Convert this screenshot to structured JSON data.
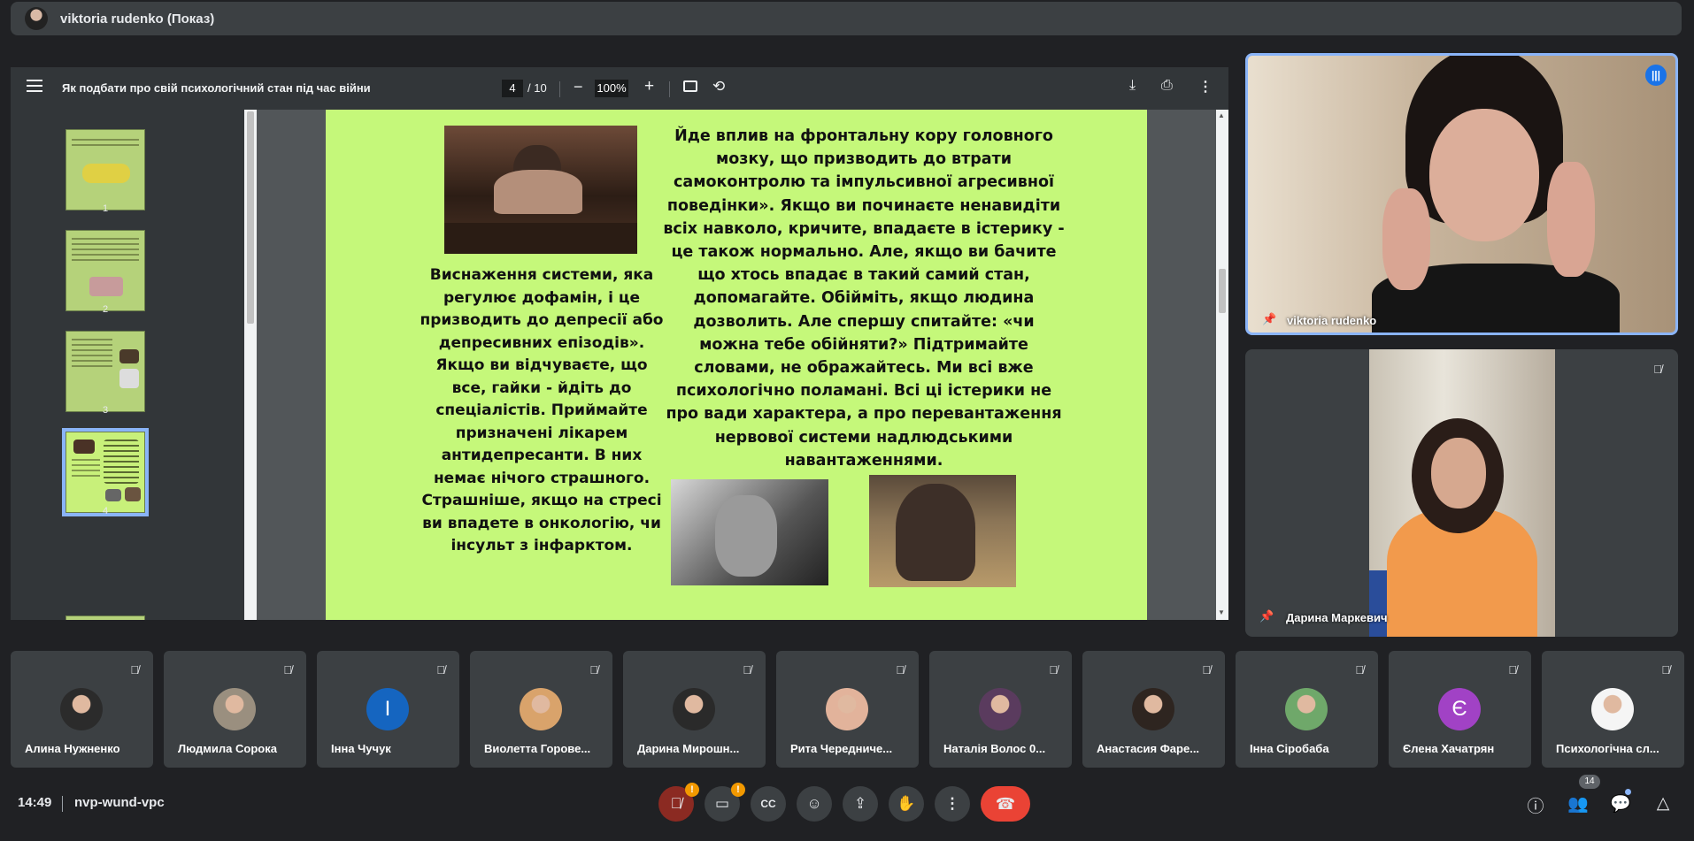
{
  "presenter_bar": {
    "title": "viktoria rudenko (Показ)"
  },
  "pdf": {
    "title": "Як подбати про свій психологічний стан під час війни",
    "page_current": "4",
    "page_total": "/ 10",
    "zoom": "100%",
    "thumbnail_numbers": [
      "1",
      "2",
      "3",
      "4"
    ],
    "slide_text_left": "Виснаження системи, яка\nрегулює дофамін, і це\nпризводить до депресії або\nдепресивних епізодів».\nЯкщо ви відчуваєте, що\nвсе, гайки - йдіть до\nспеціалістів. Приймайте\nпризначені лікарем\nантидепресанти. В них\nнемає нічого страшного.\nСтрашніше, якщо на стресі\nви впадете в онкологію, чи\nінсульт з інфарктом.",
    "slide_text_right": "Йде вплив на фронтальну кору головного\nмозку, що призводить до втрати\nсамоконтролю та імпульсивної агресивної\nповедінки». Якщо ви починаєте ненавидіти\nвсіх навколо, кричите, впадаєте в істерику -\nце також нормально. Але, якщо ви бачите\nщо хтось впадає в такий самий стан,\nдопомагайте. Обійміть, якщо людина\nдозволить. Але спершу спитайте: «чи\nможна тебе обійняти?» Підтримайте\nсловами, не ображайтесь. Ми всі вже\nпсихологічно поламані. Всі ці істерики не\nпро вади характера, а про перевантаження\nнервової системи надлюдськими\nнавантаженнями.",
    "icons": {
      "menu": "menu-icon",
      "fit": "fit-page-icon",
      "rotate": "rotate-icon",
      "download": "download-icon",
      "print": "print-icon",
      "more": "more-vert-icon"
    }
  },
  "main_tiles": [
    {
      "name": "viktoria rudenko"
    },
    {
      "name": "Дарина Маркевич"
    }
  ],
  "participants": [
    {
      "name": "Алина Нужненко",
      "initial": "",
      "color": "#2b2b2b"
    },
    {
      "name": "Людмила Сорока",
      "initial": "",
      "color": "#9a8f7f"
    },
    {
      "name": "Інна Чучук",
      "initial": "І",
      "color": "#1565c0"
    },
    {
      "name": "Виолетта Горове...",
      "initial": "",
      "color": "#d9a36b"
    },
    {
      "name": "Дарина Мирошн...",
      "initial": "",
      "color": "#2a2a2a"
    },
    {
      "name": "Рита Чередниче...",
      "initial": "",
      "color": "#e2b39b"
    },
    {
      "name": "Наталія Волос 0...",
      "initial": "",
      "color": "#5a3b5e"
    },
    {
      "name": "Анастасия Фаре...",
      "initial": "",
      "color": "#2e2520"
    },
    {
      "name": "Інна Сіробаба",
      "initial": "",
      "color": "#6fa86a"
    },
    {
      "name": "Єлена Хачатрян",
      "initial": "Є",
      "color": "#a142c5"
    },
    {
      "name": "Психологічна сл...",
      "initial": "",
      "color": "#f5f5f5"
    }
  ],
  "bottom_bar": {
    "time": "14:49",
    "meeting_code": "nvp-wund-vpc",
    "participant_count": "14",
    "controls": [
      "mic-off-icon",
      "camera-off-icon",
      "captions-icon",
      "emoji-icon",
      "present-icon",
      "raise-hand-icon",
      "more-options-icon",
      "hang-up-icon"
    ],
    "warning_mark": "!"
  },
  "colors": {
    "slide_bg": "#c5f87a",
    "active_tile_border": "#8ab4f8",
    "hangup": "#ea4335",
    "muted_mic_bg": "#8b2a22"
  }
}
